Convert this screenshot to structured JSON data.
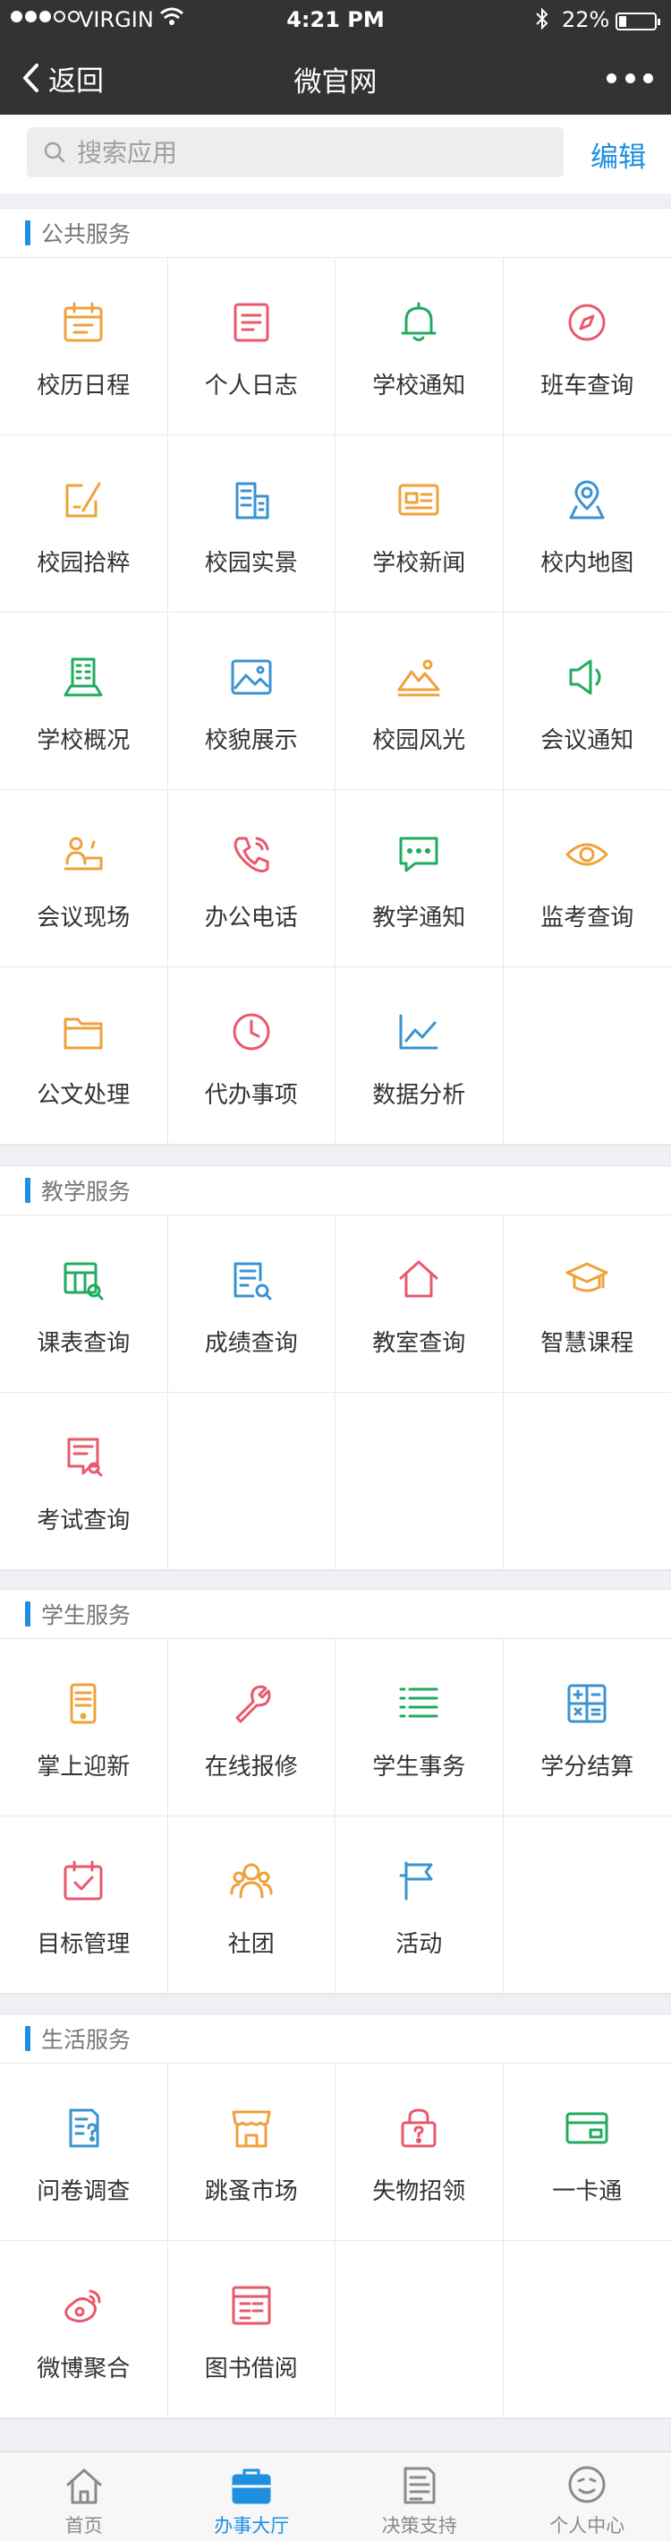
{
  "status_bar": {
    "carrier": "VIRGIN",
    "time": "4:21 PM",
    "battery": "22%",
    "battery_level": 0.22
  },
  "nav": {
    "back_label": "返回",
    "title": "微官网"
  },
  "search": {
    "placeholder": "搜索应用",
    "edit_label": "编辑"
  },
  "colors": {
    "accent": "#1e8fe1",
    "orange": "#f0a13a",
    "red": "#e8596b",
    "green": "#1fac5f",
    "blue": "#3a93d1",
    "nav_bg": "#333334"
  },
  "sections": [
    {
      "title": "公共服务",
      "items": [
        {
          "label": "校历日程",
          "icon": "calendar-icon",
          "color": "#f0a13a"
        },
        {
          "label": "个人日志",
          "icon": "notebook-icon",
          "color": "#e8596b"
        },
        {
          "label": "学校通知",
          "icon": "bell-icon",
          "color": "#1fac5f"
        },
        {
          "label": "班车查询",
          "icon": "compass-icon",
          "color": "#e8596b"
        },
        {
          "label": "校园拾粹",
          "icon": "pen-box-icon",
          "color": "#f0a13a"
        },
        {
          "label": "校园实景",
          "icon": "buildings-icon",
          "color": "#3a93d1"
        },
        {
          "label": "学校新闻",
          "icon": "news-card-icon",
          "color": "#f0a13a"
        },
        {
          "label": "校内地图",
          "icon": "map-pin-icon",
          "color": "#3a93d1"
        },
        {
          "label": "学校概况",
          "icon": "building-icon",
          "color": "#1fac5f"
        },
        {
          "label": "校貌展示",
          "icon": "picture-icon",
          "color": "#3a93d1"
        },
        {
          "label": "校园风光",
          "icon": "landscape-icon",
          "color": "#f0a13a"
        },
        {
          "label": "会议通知",
          "icon": "speaker-icon",
          "color": "#1fac5f"
        },
        {
          "label": "会议现场",
          "icon": "presenter-icon",
          "color": "#f0a13a"
        },
        {
          "label": "办公电话",
          "icon": "phone-icon",
          "color": "#e8596b"
        },
        {
          "label": "教学通知",
          "icon": "chat-bubble-icon",
          "color": "#1fac5f"
        },
        {
          "label": "监考查询",
          "icon": "eye-icon",
          "color": "#f0a13a"
        },
        {
          "label": "公文处理",
          "icon": "folder-icon",
          "color": "#f0a13a"
        },
        {
          "label": "代办事项",
          "icon": "clock-icon",
          "color": "#e8596b"
        },
        {
          "label": "数据分析",
          "icon": "line-chart-icon",
          "color": "#3a93d1"
        }
      ]
    },
    {
      "title": "教学服务",
      "items": [
        {
          "label": "课表查询",
          "icon": "timetable-search-icon",
          "color": "#1fac5f"
        },
        {
          "label": "成绩查询",
          "icon": "score-search-icon",
          "color": "#3a93d1"
        },
        {
          "label": "教室查询",
          "icon": "house-icon",
          "color": "#e8596b"
        },
        {
          "label": "智慧课程",
          "icon": "graduation-cap-icon",
          "color": "#f0a13a"
        },
        {
          "label": "考试查询",
          "icon": "exam-search-icon",
          "color": "#e8596b"
        }
      ]
    },
    {
      "title": "学生服务",
      "items": [
        {
          "label": "掌上迎新",
          "icon": "mobile-icon",
          "color": "#f0a13a"
        },
        {
          "label": "在线报修",
          "icon": "wrench-icon",
          "color": "#e8596b"
        },
        {
          "label": "学生事务",
          "icon": "list-icon",
          "color": "#1fac5f"
        },
        {
          "label": "学分结算",
          "icon": "calculator-icon",
          "color": "#3a93d1"
        },
        {
          "label": "目标管理",
          "icon": "calendar-check-icon",
          "color": "#e8596b"
        },
        {
          "label": "社团",
          "icon": "group-icon",
          "color": "#f0a13a"
        },
        {
          "label": "活动",
          "icon": "flag-icon",
          "color": "#3a93d1"
        }
      ]
    },
    {
      "title": "生活服务",
      "items": [
        {
          "label": "问卷调查",
          "icon": "questionnaire-icon",
          "color": "#3a93d1"
        },
        {
          "label": "跳蚤市场",
          "icon": "shop-icon",
          "color": "#f0a13a"
        },
        {
          "label": "失物招领",
          "icon": "lock-question-icon",
          "color": "#e8596b"
        },
        {
          "label": "一卡通",
          "icon": "card-icon",
          "color": "#1fac5f"
        },
        {
          "label": "微博聚合",
          "icon": "weibo-icon",
          "color": "#e8596b"
        },
        {
          "label": "图书借阅",
          "icon": "book-icon",
          "color": "#e8596b"
        }
      ]
    }
  ],
  "tabs": [
    {
      "label": "首页",
      "icon": "home-icon",
      "active": false
    },
    {
      "label": "办事大厅",
      "icon": "briefcase-icon",
      "active": true
    },
    {
      "label": "决策支持",
      "icon": "document-icon",
      "active": false
    },
    {
      "label": "个人中心",
      "icon": "smiley-icon",
      "active": false
    }
  ]
}
